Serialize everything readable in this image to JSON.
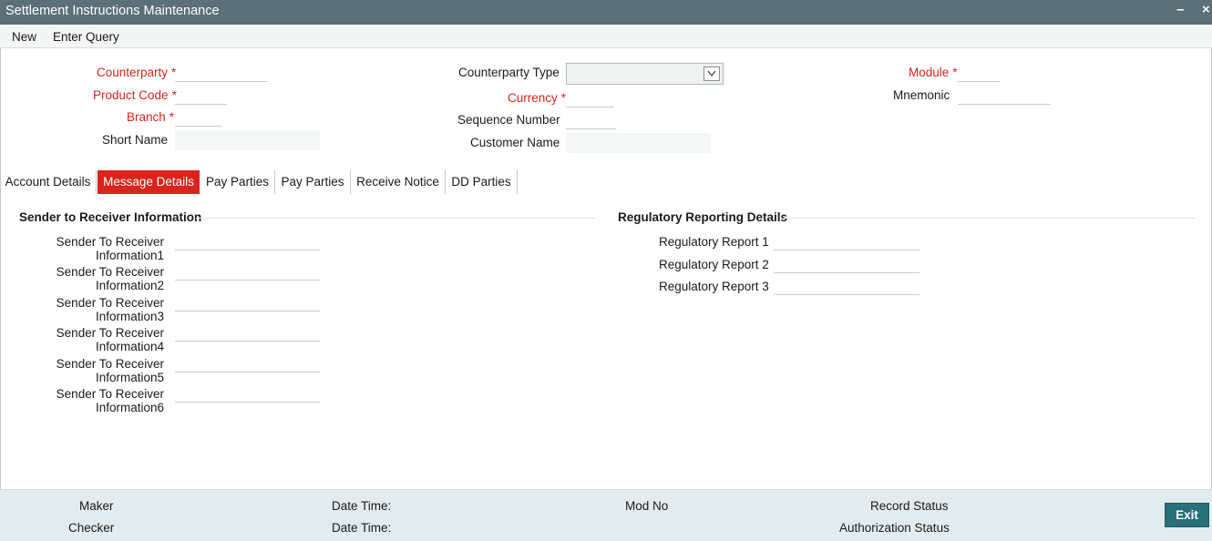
{
  "window": {
    "title": "Settlement Instructions Maintenance",
    "minimize_glyph": "–",
    "close_glyph": "×"
  },
  "menu": {
    "new": "New",
    "enter_query": "Enter Query"
  },
  "header": {
    "counterparty": {
      "label": "Counterparty",
      "value": ""
    },
    "product_code": {
      "label": "Product Code",
      "value": ""
    },
    "branch": {
      "label": "Branch",
      "value": ""
    },
    "short_name": {
      "label": "Short Name",
      "value": ""
    },
    "counterparty_type": {
      "label": "Counterparty Type",
      "value": ""
    },
    "currency": {
      "label": "Currency",
      "value": ""
    },
    "sequence_number": {
      "label": "Sequence Number",
      "value": ""
    },
    "customer_name": {
      "label": "Customer Name",
      "value": ""
    },
    "module": {
      "label": "Module",
      "value": ""
    },
    "mnemonic": {
      "label": "Mnemonic",
      "value": ""
    },
    "required_marker": "*"
  },
  "tabs": [
    {
      "label": "Account Details",
      "active": false
    },
    {
      "label": "Message Details",
      "active": true
    },
    {
      "label": "Pay Parties",
      "active": false
    },
    {
      "label": "Pay Parties",
      "active": false
    },
    {
      "label": "Receive Notice",
      "active": false
    },
    {
      "label": "DD Parties",
      "active": false
    }
  ],
  "sender_section": {
    "title": "Sender to Receiver Information",
    "fields": [
      {
        "line1": "Sender To Receiver",
        "line2": "Information1",
        "value": ""
      },
      {
        "line1": "Sender To Receiver",
        "line2": "Information2",
        "value": ""
      },
      {
        "line1": "Sender To Receiver",
        "line2": "Information3",
        "value": ""
      },
      {
        "line1": "Sender To Receiver",
        "line2": "Information4",
        "value": ""
      },
      {
        "line1": "Sender To Receiver",
        "line2": "Information5",
        "value": ""
      },
      {
        "line1": "Sender To Receiver",
        "line2": "Information6",
        "value": ""
      }
    ]
  },
  "regulatory_section": {
    "title": "Regulatory Reporting Details",
    "fields": [
      {
        "label": "Regulatory Report 1",
        "value": ""
      },
      {
        "label": "Regulatory Report 2",
        "value": ""
      },
      {
        "label": "Regulatory Report 3",
        "value": ""
      }
    ]
  },
  "footer": {
    "maker": "Maker",
    "checker": "Checker",
    "date_time_1": "Date Time:",
    "date_time_2": "Date Time:",
    "mod_no": "Mod No",
    "record_status": "Record Status",
    "authorization_status": "Authorization Status",
    "exit": "Exit"
  },
  "colors": {
    "titlebar": "#5b7078",
    "required": "#d8241c",
    "active_tab": "#d8241c",
    "footer_bg": "#e2ecee",
    "exit_button": "#27707c"
  }
}
